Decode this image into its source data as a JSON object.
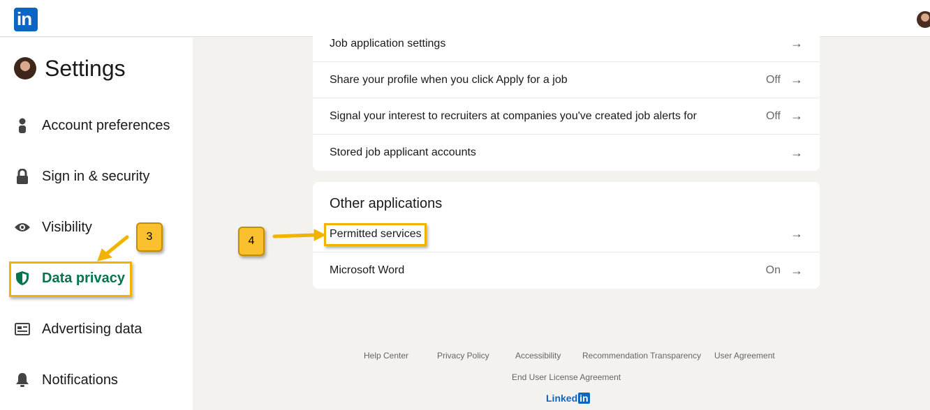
{
  "header": {
    "logo_text": "in"
  },
  "sidebar": {
    "title": "Settings",
    "items": [
      {
        "label": "Account preferences",
        "icon": "person-icon"
      },
      {
        "label": "Sign in & security",
        "icon": "lock-icon"
      },
      {
        "label": "Visibility",
        "icon": "eye-icon"
      },
      {
        "label": "Data privacy",
        "icon": "shield-icon",
        "active": true
      },
      {
        "label": "Advertising data",
        "icon": "newspaper-icon"
      },
      {
        "label": "Notifications",
        "icon": "bell-icon"
      }
    ]
  },
  "job_card": {
    "rows": [
      {
        "label": "Job application settings",
        "status": ""
      },
      {
        "label": "Share your profile when you click Apply for a job",
        "status": "Off"
      },
      {
        "label": "Signal your interest to recruiters at companies you've created job alerts for",
        "status": "Off"
      },
      {
        "label": "Stored job applicant accounts",
        "status": ""
      }
    ]
  },
  "other_card": {
    "heading": "Other applications",
    "rows": [
      {
        "label": "Permitted services",
        "status": ""
      },
      {
        "label": "Microsoft Word",
        "status": "On"
      }
    ]
  },
  "annotations": {
    "step3": "3",
    "step4": "4"
  },
  "footer": {
    "links": [
      "Help Center",
      "Privacy Policy",
      "Accessibility",
      "Recommendation Transparency",
      "User Agreement",
      "End User License Agreement"
    ],
    "brand_text": "Linked",
    "brand_in": "in"
  },
  "colors": {
    "brand": "#0a66c2",
    "active": "#01754f",
    "highlight": "#f0b400",
    "callout": "#fbc02d"
  }
}
